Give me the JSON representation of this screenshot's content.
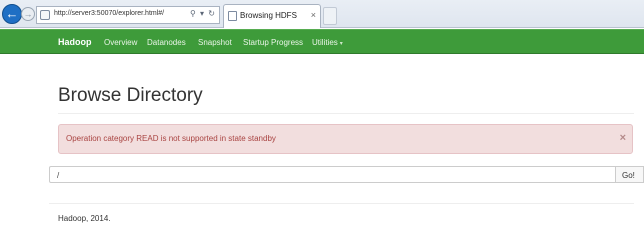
{
  "browser": {
    "address_url": "http://server3:50070/explorer.html#/",
    "address_tools": "⚲ ▾ ↻",
    "tab_title": "Browsing HDFS",
    "tab_close": "×"
  },
  "navbar": {
    "brand": "Hadoop",
    "items": [
      "Overview",
      "Datanodes",
      "Snapshot",
      "Startup Progress",
      "Utilities"
    ],
    "utilities_caret": "▾"
  },
  "page": {
    "title": "Browse Directory",
    "alert": {
      "message": "Operation category READ is not supported in state standby",
      "close": "×",
      "colors": {
        "background": "#f2dede",
        "text": "#a94442"
      }
    },
    "path_value": "/",
    "go_label": "Go!",
    "footer": "Hadoop, 2014."
  },
  "colors": {
    "navbar": "#3e9b3a",
    "back_button": "#1f6fc4"
  }
}
